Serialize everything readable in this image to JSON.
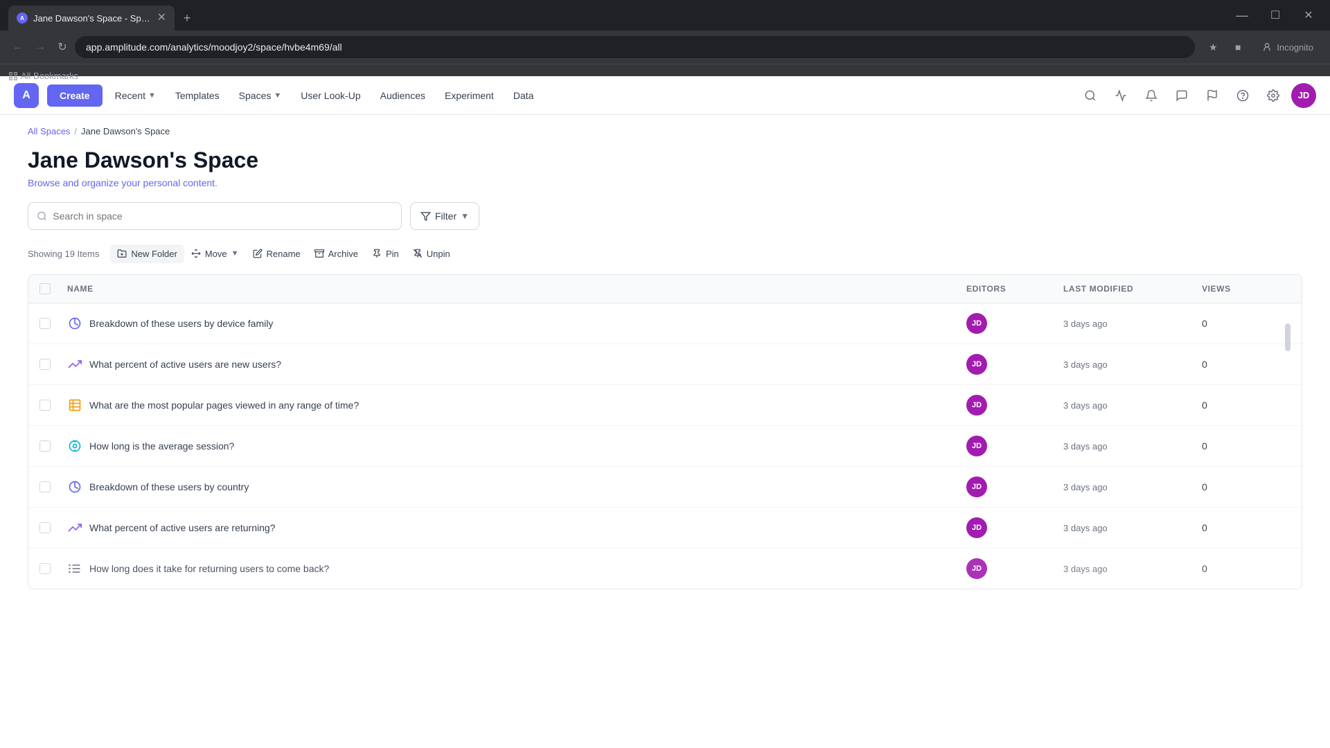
{
  "browser": {
    "tab_title": "Jane Dawson's Space - Space",
    "tab_favicon": "A",
    "url": "app.amplitude.com/analytics/moodjoy2/space/hvbe4m69/all",
    "incognito_label": "Incognito",
    "bookmarks_label": "All Bookmarks"
  },
  "nav": {
    "logo_text": "A",
    "create_label": "Create",
    "items": [
      {
        "label": "Recent",
        "has_dropdown": true
      },
      {
        "label": "Templates",
        "has_dropdown": false
      },
      {
        "label": "Spaces",
        "has_dropdown": true
      },
      {
        "label": "User Look-Up",
        "has_dropdown": false
      },
      {
        "label": "Audiences",
        "has_dropdown": false
      },
      {
        "label": "Experiment",
        "has_dropdown": false
      },
      {
        "label": "Data",
        "has_dropdown": false
      }
    ]
  },
  "breadcrumb": {
    "all_spaces": "All Spaces",
    "separator": "/",
    "current": "Jane Dawson's Space"
  },
  "page": {
    "title": "Jane Dawson's Space",
    "subtitle": "Browse and organize your personal content."
  },
  "search": {
    "placeholder": "Search in space"
  },
  "filter": {
    "label": "Filter"
  },
  "toolbar": {
    "showing_label": "Showing 19 Items",
    "new_folder": "New Folder",
    "move": "Move",
    "rename": "Rename",
    "archive": "Archive",
    "pin": "Pin",
    "unpin": "Unpin"
  },
  "table": {
    "headers": [
      "",
      "NAME",
      "EDITORS",
      "LAST MODIFIED",
      "VIEWS",
      ""
    ],
    "rows": [
      {
        "name": "Breakdown of these users by device family",
        "icon_type": "segment",
        "editor_initials": "JD",
        "last_modified": "3 days ago",
        "views": "0"
      },
      {
        "name": "What percent of active users are new users?",
        "icon_type": "retention",
        "editor_initials": "JD",
        "last_modified": "3 days ago",
        "views": "0"
      },
      {
        "name": "What are the most popular pages viewed in any range of time?",
        "icon_type": "table",
        "editor_initials": "JD",
        "last_modified": "3 days ago",
        "views": "0"
      },
      {
        "name": "How long is the average session?",
        "icon_type": "compass",
        "editor_initials": "JD",
        "last_modified": "3 days ago",
        "views": "0"
      },
      {
        "name": "Breakdown of these users by country",
        "icon_type": "segment",
        "editor_initials": "JD",
        "last_modified": "3 days ago",
        "views": "0"
      },
      {
        "name": "What percent of active users are returning?",
        "icon_type": "retention",
        "editor_initials": "JD",
        "last_modified": "3 days ago",
        "views": "0"
      },
      {
        "name": "How long does it take for returning users to come back?",
        "icon_type": "funnel",
        "editor_initials": "JD",
        "last_modified": "3 days ago",
        "views": "0"
      }
    ]
  },
  "user": {
    "initials": "JD"
  }
}
